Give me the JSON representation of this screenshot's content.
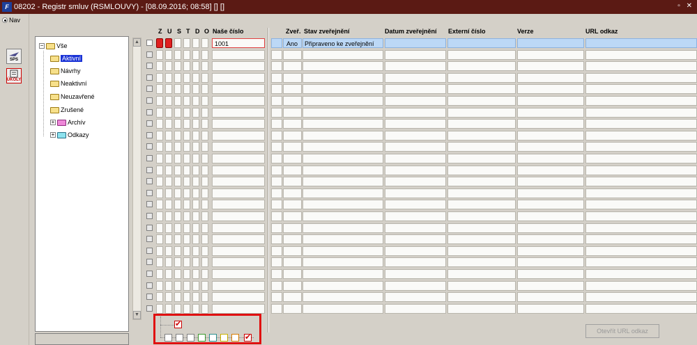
{
  "window": {
    "title": "08202 - Registr smluv (RSMLOUVY) - [08.09.2016; 08:58] [] []",
    "icon_text": "F",
    "controls": "▫ ✕"
  },
  "nav": {
    "label": "Nav"
  },
  "toolbar": {
    "sps_label": "SPS",
    "ukoly_label": "ÚKOLY"
  },
  "tree": {
    "root": "Vše",
    "items": [
      "Aktivní",
      "Návrhy",
      "Neaktivní",
      "Neuzavřené",
      "Zrušené",
      "Archív",
      "Odkazy"
    ]
  },
  "grid": {
    "flag_headers": [
      "Z",
      "U",
      "S",
      "T",
      "D",
      "O"
    ],
    "headers": {
      "nase_cislo": "Naše číslo",
      "zver": "Zveř.",
      "stav": "Stav zveřejnění",
      "datum": "Datum zveřejnění",
      "externi": "Externí číslo",
      "verze": "Verze",
      "url": "URL odkaz"
    },
    "rows": [
      {
        "nase_cislo": "1001",
        "zver": "Ano",
        "stav": "Připraveno ke zveřejnění"
      }
    ],
    "total_rows": 24
  },
  "buttons": {
    "open_url": "Otevřít URL odkaz"
  },
  "colors": {
    "titlebar": "#5b1a14",
    "selection": "#1a33d6",
    "row_highlight": "#bcd8f6",
    "flag_red": "#e02020",
    "callout": "#e01010"
  }
}
